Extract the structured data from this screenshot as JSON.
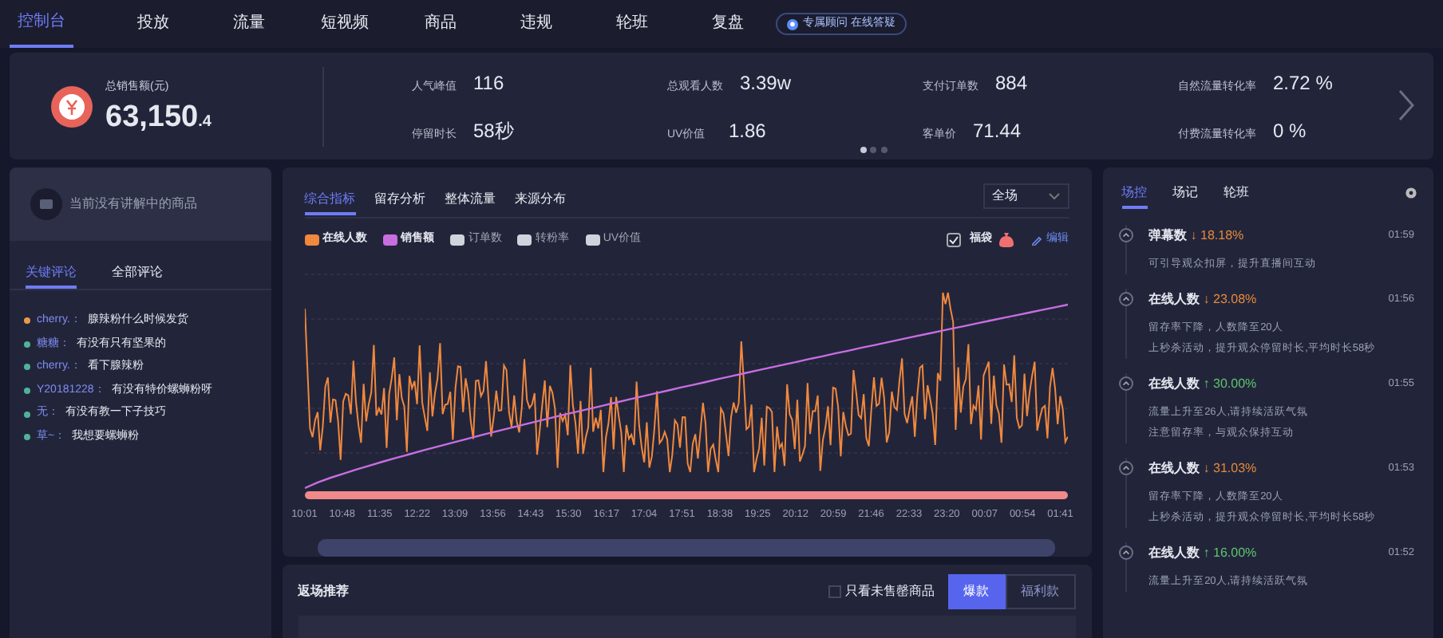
{
  "nav": {
    "tabs": [
      {
        "label": "控制台",
        "selected": true
      },
      {
        "label": "投放",
        "selected": false
      },
      {
        "label": "流量",
        "selected": false
      },
      {
        "label": "短视频",
        "selected": false
      },
      {
        "label": "商品",
        "selected": false
      },
      {
        "label": "违规",
        "selected": false
      },
      {
        "label": "轮班",
        "selected": false
      },
      {
        "label": "复盘",
        "selected": false
      }
    ],
    "badge": "专属顾问 在线答疑"
  },
  "summary": {
    "label": "总销售额(元)",
    "value": "63,150",
    "decimal": ".4",
    "stats": [
      {
        "label": "人气峰值",
        "value": "116"
      },
      {
        "label": "总观看人数",
        "value": "3.39w"
      },
      {
        "label": "支付订单数",
        "value": "884"
      },
      {
        "label": "自然流量转化率",
        "value": "2.72 %"
      },
      {
        "label": "停留时长",
        "value": "58秒"
      },
      {
        "label": "UV价值",
        "value": "1.86"
      },
      {
        "label": "客单价",
        "value": "71.44"
      },
      {
        "label": "付费流量转化率",
        "value": "0 %"
      }
    ],
    "pages": [
      {
        "selected": true
      },
      {
        "selected": false
      },
      {
        "selected": false
      }
    ]
  },
  "product": {
    "text": "当前没有讲解中的商品"
  },
  "comments": {
    "tabs": [
      {
        "label": "关键评论",
        "selected": true
      },
      {
        "label": "全部评论",
        "selected": false
      }
    ],
    "items": [
      {
        "user": "cherry.：",
        "text": "腺辣粉什么时候发货",
        "color": "#e89a4a"
      },
      {
        "user": "糖糖：",
        "text": "有没有只有坚果的",
        "color": "#4fb39a"
      },
      {
        "user": "cherry.：",
        "text": "看下腺辣粉",
        "color": "#4fb39a"
      },
      {
        "user": "Y20181228：",
        "text": "有没有特价螺蛳粉呀",
        "color": "#4fb39a"
      },
      {
        "user": "无：",
        "text": "有没有教一下子技巧",
        "color": "#4fb39a"
      },
      {
        "user": "草~：",
        "text": "我想要螺蛳粉",
        "color": "#4fb39a"
      }
    ]
  },
  "chart": {
    "tabs": [
      {
        "label": "综合指标",
        "selected": true
      },
      {
        "label": "留存分析",
        "selected": false
      },
      {
        "label": "整体流量",
        "selected": false
      },
      {
        "label": "来源分布",
        "selected": false
      }
    ],
    "scope": "全场",
    "legend": [
      {
        "label": "在线人数",
        "on": true,
        "color": "#f0883e"
      },
      {
        "label": "销售额",
        "on": true,
        "color": "#c86ee0"
      },
      {
        "label": "订单数",
        "on": false,
        "color": "#cfd3dc"
      },
      {
        "label": "转粉率",
        "on": false,
        "color": "#cfd3dc"
      },
      {
        "label": "UV价值",
        "on": false,
        "color": "#cfd3dc"
      }
    ],
    "bag": {
      "label": "福袋",
      "checked": true
    },
    "edit": "编辑",
    "range": {
      "level": 1
    },
    "x_labels": [
      "10:01",
      "10:48",
      "11:35",
      "12:22",
      "13:09",
      "13:56",
      "14:43",
      "15:30",
      "16:17",
      "17:04",
      "17:51",
      "18:38",
      "19:25",
      "20:12",
      "20:59",
      "21:46",
      "22:33",
      "23:20",
      "00:07",
      "00:54",
      "01:41"
    ]
  },
  "recommend": {
    "title": "返场推荐",
    "filter": {
      "label": "只看未售罄商品",
      "checked": false
    },
    "options": [
      {
        "label": "爆款",
        "selected": true
      },
      {
        "label": "福利款",
        "selected": false
      }
    ]
  },
  "monitor": {
    "tabs": [
      {
        "label": "场控",
        "selected": true
      },
      {
        "label": "场记",
        "selected": false
      },
      {
        "label": "轮班",
        "selected": false
      }
    ],
    "events": [
      {
        "metric": "弹幕数",
        "color": "#e8893a",
        "change": "↓ 18.18%",
        "time": "01:59",
        "lines": [
          "可引导观众扣屏，提升直播间互动"
        ]
      },
      {
        "metric": "在线人数",
        "color": "#e8893a",
        "change": "↓ 23.08%",
        "time": "01:56",
        "lines": [
          "留存率下降，人数降至20人",
          "上秒杀活动，提升观众停留时长,平均时长58秒"
        ]
      },
      {
        "metric": "在线人数",
        "color": "#5fc46e",
        "change": "↑ 30.00%",
        "time": "01:55",
        "lines": [
          "流量上升至26人,请持续活跃气氛",
          "注意留存率，与观众保持互动"
        ]
      },
      {
        "metric": "在线人数",
        "color": "#e8893a",
        "change": "↓ 31.03%",
        "time": "01:53",
        "lines": [
          "留存率下降，人数降至20人",
          "上秒杀活动，提升观众停留时长,平均时长58秒"
        ]
      },
      {
        "metric": "在线人数",
        "color": "#5fc46e",
        "change": "↑ 16.00%",
        "time": "01:52",
        "lines": [
          "流量上升至20人,请持续活跃气氛"
        ]
      }
    ]
  }
}
